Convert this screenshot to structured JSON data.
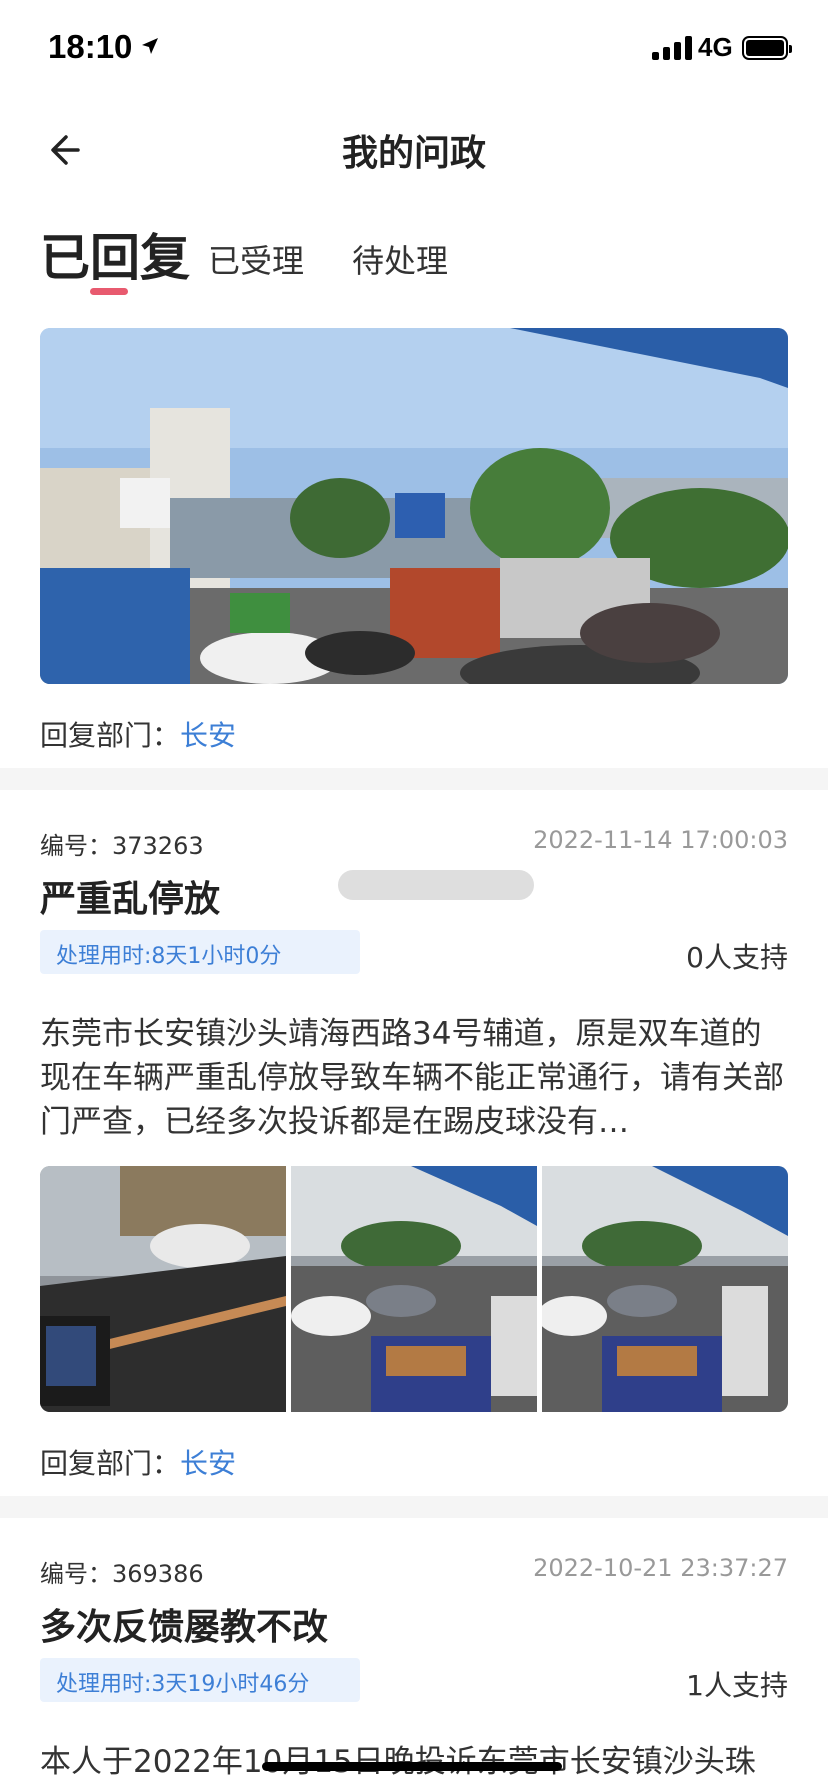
{
  "status_bar": {
    "time": "18:10",
    "network": "4G",
    "icons": [
      "location-arrow-icon",
      "signal-icon",
      "battery-icon"
    ]
  },
  "nav": {
    "title": "我的问政",
    "back_icon": "back-arrow-icon"
  },
  "tabs": [
    {
      "label": "已回复",
      "active": true
    },
    {
      "label": "已受理",
      "active": false
    },
    {
      "label": "待处理",
      "active": false
    }
  ],
  "accent_colors": {
    "tab_indicator": "#e85a6f",
    "link": "#3d7fd6",
    "badge_bg": "#eaf2fd"
  },
  "first_item": {
    "dept_label": "回复部门：",
    "dept_value": "长安"
  },
  "cards": [
    {
      "id_label": "编号：",
      "id": "373263",
      "timestamp": "2022-11-14 17:00:03",
      "title": "严重乱停放",
      "duration": "处理用时:8天1小时0分",
      "support": "0人支持",
      "content": "东莞市长安镇沙头靖海西路34号辅道，原是双车道的现在车辆严重乱停放导致车辆不能正常通行，请有关部门严查，已经多次投诉都是在踢皮球没有…",
      "dept_label": "回复部门：",
      "dept_value": "长安"
    },
    {
      "id_label": "编号：",
      "id": "369386",
      "timestamp": "2022-10-21 23:37:27",
      "title": "多次反馈屡教不改",
      "duration": "处理用时:3天19小时46分",
      "support": "1人支持",
      "content": "本人于2022年10月15日晚投诉东莞市长安镇沙头珠"
    }
  ]
}
